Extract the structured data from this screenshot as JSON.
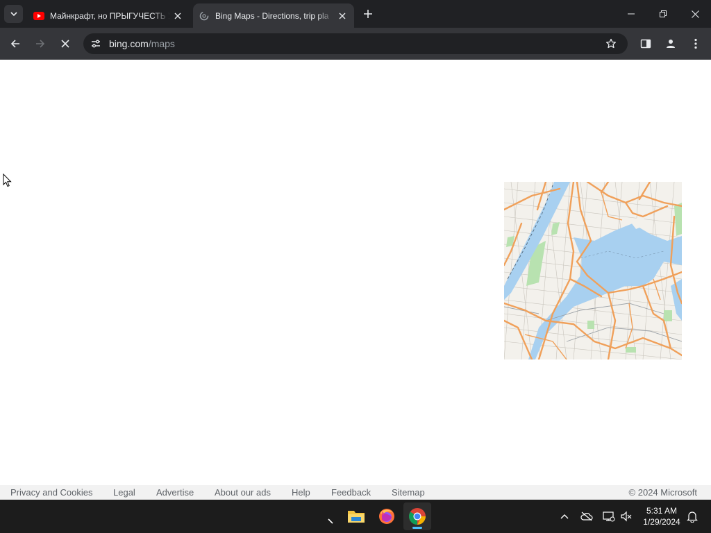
{
  "browser": {
    "tabs": [
      {
        "title": "Майнкрафт, но ПРЫГУЧЕСТЬ У",
        "favicon": "youtube-icon",
        "active": false
      },
      {
        "title": "Bing Maps - Directions, trip pla",
        "favicon": "bing-loading-icon",
        "active": true
      }
    ],
    "address_host": "bing.com",
    "address_path": "/maps"
  },
  "footer": {
    "links": [
      "Privacy and Cookies",
      "Legal",
      "Advertise",
      "About our ads",
      "Help",
      "Feedback",
      "Sitemap"
    ],
    "copyright": "© 2024 Microsoft"
  },
  "taskbar": {
    "apps": [
      "file-explorer-icon",
      "firefox-icon",
      "chrome-icon"
    ],
    "time": "5:31 AM",
    "date": "1/29/2024"
  },
  "colors": {
    "chrome_dark": "#202124",
    "chrome_toolbar": "#35363a",
    "map_road": "#f0a05a",
    "map_water": "#a8d0f0",
    "map_park": "#b8e2b0"
  }
}
